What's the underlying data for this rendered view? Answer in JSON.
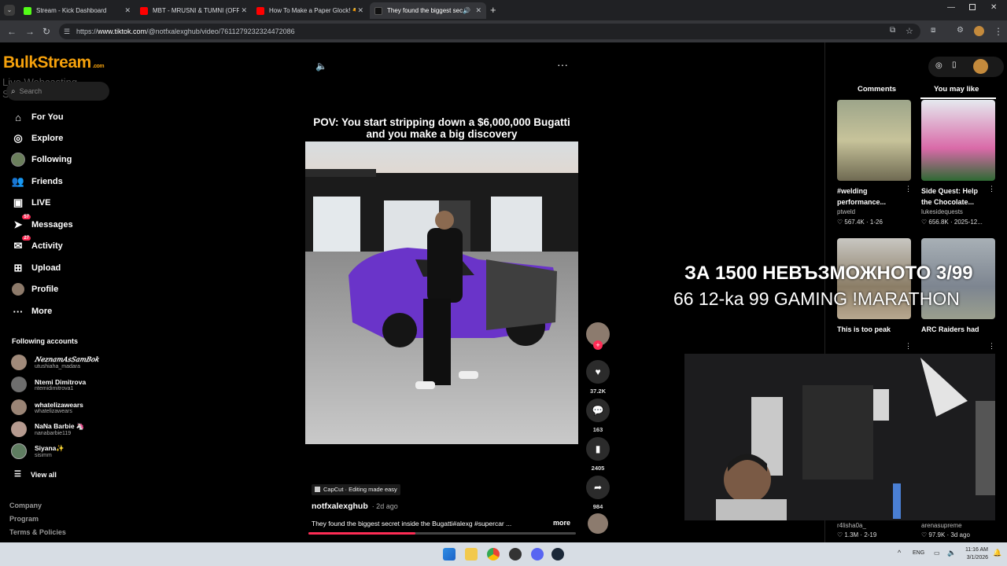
{
  "browser": {
    "tabs": [
      {
        "label": "Stream - Kick Dashboard",
        "color": "#53fc18"
      },
      {
        "label": "MBT - MRUSNI & TUMNI (OFFI",
        "color": "#ff0000"
      },
      {
        "label": "How To Make a Paper Glock! 🔫",
        "color": "#ff0000"
      },
      {
        "label": "They found the biggest sec",
        "color": "#111111"
      }
    ],
    "url_prefix": "https://",
    "url_domain": "www.tiktok.com",
    "url_path": "/@notfxalexghub/video/7611279232324472086"
  },
  "watermark": {
    "brand": "BulkStream",
    "sub": "Live Webcasting Services",
    "small": ".com"
  },
  "sidebar": {
    "search_placeholder": "Search",
    "nav": [
      {
        "label": "For You",
        "icon": "home-icon"
      },
      {
        "label": "Explore",
        "icon": "compass-icon"
      },
      {
        "label": "Following",
        "icon": "following-avatar"
      },
      {
        "label": "Friends",
        "icon": "friends-icon"
      },
      {
        "label": "LIVE",
        "icon": "live-icon"
      },
      {
        "label": "Messages",
        "icon": "messages-icon",
        "badge": "57"
      },
      {
        "label": "Activity",
        "icon": "activity-icon",
        "badge": "27"
      },
      {
        "label": "Upload",
        "icon": "upload-icon"
      },
      {
        "label": "Profile",
        "icon": "profile-avatar"
      },
      {
        "label": "More",
        "icon": "more-icon"
      }
    ],
    "following_title": "Following accounts",
    "accounts": [
      {
        "name": "𝑁𝑒𝑧𝑛𝑎𝑚𝐴𝑠𝑆𝑎𝑚𝐵𝑜𝑘",
        "handle": "utushiaha_madara"
      },
      {
        "name": "Ntemi Dimitrova",
        "handle": "ntemidimitrova1"
      },
      {
        "name": "whatelizawears",
        "handle": "whatelizawears"
      },
      {
        "name": "NaNa Barbie 🦄",
        "handle": "nanabarbie119"
      },
      {
        "name": "Siyana✨",
        "handle": "sisimm"
      }
    ],
    "view_all": "View all",
    "footer": [
      "Company",
      "Program",
      "Terms & Policies"
    ]
  },
  "video": {
    "caption_title": "POV: You start stripping down a $6,000,000 Bugatti and you make a big discovery",
    "capcut_tag": "CapCut · Editing made easy",
    "author": "notfxalexghub",
    "posted": "· 2d ago",
    "description": "They found the biggest secret inside the Bugatti#alexg #supercar ...",
    "more": "more",
    "likes": "37.2K",
    "comments": "163",
    "saves": "2405",
    "shares": "984",
    "progress_fraction": 0.4
  },
  "right_panel": {
    "tab_comments": "Comments",
    "tab_you_may_like": "You may like",
    "cards": [
      {
        "title_line1": "#welding",
        "title_line2": "performance...",
        "user": "ptweld",
        "views": "567.4K",
        "date": "1-26"
      },
      {
        "title_line1": "Side Quest: Help",
        "title_line2": "the Chocolate...",
        "user": "lukesidequests",
        "views": "656.8K",
        "date": "2025-12..."
      },
      {
        "title_line1": "This is too peak",
        "title_line2": "",
        "user": "r4lisha0a_",
        "views": "1.3M",
        "date": "2-19"
      },
      {
        "title_line1": "ARC Raiders had",
        "title_line2": "...",
        "user": "arenasupreme",
        "views": "97.9K",
        "date": "3d ago"
      }
    ]
  },
  "stream_overlay": {
    "line1": "ЗА 1500 НЕВЪЗМОЖНОТО 3/99",
    "line2": "66 12-ka 99 GAMING !MARATHON"
  },
  "taskbar": {
    "lang": "ENG",
    "time": "11:16 AM",
    "date": "3/1/2026"
  }
}
